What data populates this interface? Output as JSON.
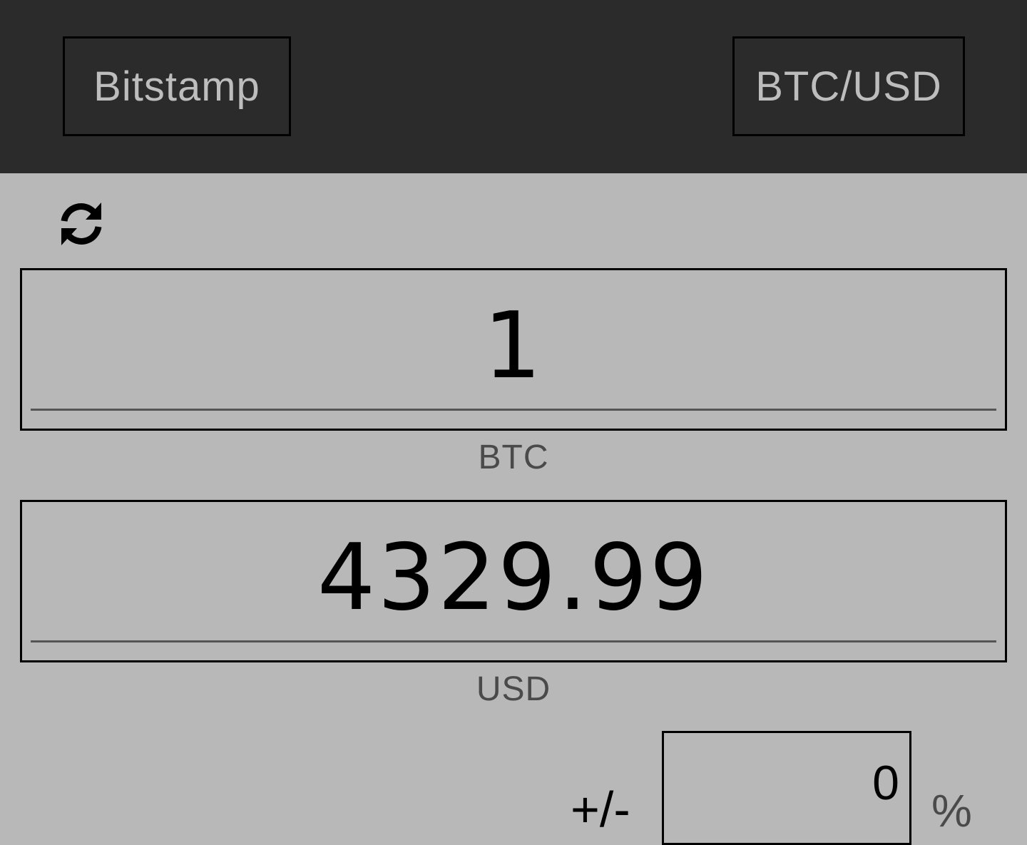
{
  "header": {
    "exchange_label": "Bitstamp",
    "pair_label": "BTC/USD"
  },
  "refresh": {
    "icon": "refresh-icon"
  },
  "converter": {
    "base_amount": "1",
    "base_unit": "BTC",
    "quote_amount": "4329.99",
    "quote_unit": "USD"
  },
  "adjustment": {
    "sign_label": "+/-",
    "percent_value": "0",
    "percent_symbol": "%"
  },
  "colors": {
    "topbar": "#2b2b2b",
    "background": "#b8b8b8",
    "button_text": "#bdbdbd"
  }
}
